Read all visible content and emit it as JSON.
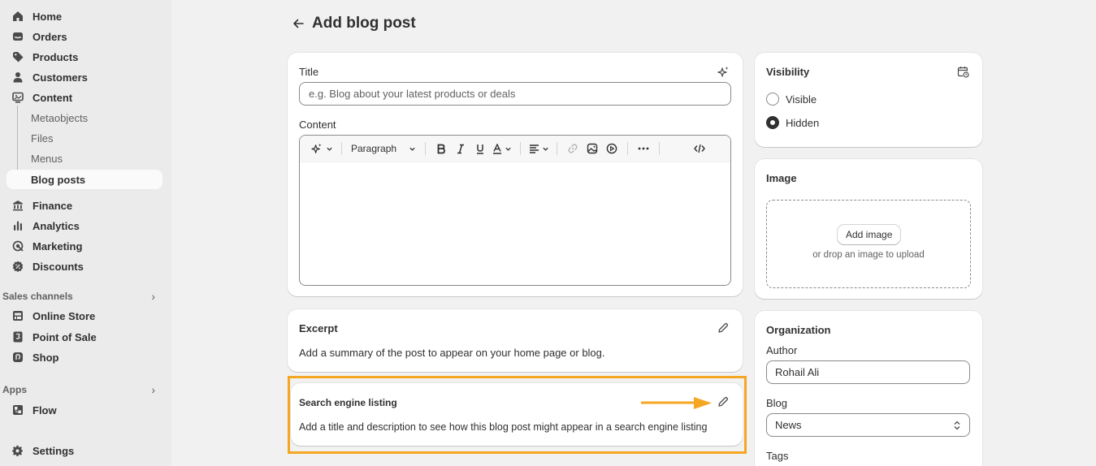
{
  "sidebar": {
    "items": [
      {
        "label": "Home",
        "icon": "home-icon"
      },
      {
        "label": "Orders",
        "icon": "inbox-icon"
      },
      {
        "label": "Products",
        "icon": "tag-icon"
      },
      {
        "label": "Customers",
        "icon": "person-icon"
      },
      {
        "label": "Content",
        "icon": "content-icon"
      }
    ],
    "content_sub": [
      "Metaobjects",
      "Files",
      "Menus",
      "Blog posts"
    ],
    "items2": [
      {
        "label": "Finance",
        "icon": "bank-icon"
      },
      {
        "label": "Analytics",
        "icon": "bar-chart-icon"
      },
      {
        "label": "Marketing",
        "icon": "target-icon"
      },
      {
        "label": "Discounts",
        "icon": "discount-icon"
      }
    ],
    "sales_channels_label": "Sales channels",
    "channels": [
      {
        "label": "Online Store",
        "icon": "store-icon"
      },
      {
        "label": "Point of Sale",
        "icon": "pos-icon"
      },
      {
        "label": "Shop",
        "icon": "shop-icon"
      }
    ],
    "apps_label": "Apps",
    "apps": [
      {
        "label": "Flow",
        "icon": "flow-icon"
      }
    ],
    "settings_label": "Settings"
  },
  "page": {
    "title": "Add blog post"
  },
  "post": {
    "title_label": "Title",
    "title_placeholder": "e.g. Blog about your latest products or deals",
    "content_label": "Content",
    "format_value": "Paragraph"
  },
  "excerpt": {
    "heading": "Excerpt",
    "description": "Add a summary of the post to appear on your home page or blog."
  },
  "seo": {
    "heading": "Search engine listing",
    "description": "Add a title and description to see how this blog post might appear in a search engine listing"
  },
  "visibility": {
    "heading": "Visibility",
    "options": [
      "Visible",
      "Hidden"
    ],
    "selected": "Hidden"
  },
  "image": {
    "heading": "Image",
    "add_button": "Add image",
    "drop_hint": "or drop an image to upload"
  },
  "organization": {
    "heading": "Organization",
    "author_label": "Author",
    "author_value": "Rohail Ali",
    "blog_label": "Blog",
    "blog_value": "News",
    "tags_label": "Tags"
  },
  "colors": {
    "highlight": "#f5a623",
    "text": "#303030",
    "sidebar_bg": "#ebebeb",
    "page_bg": "#f1f1f1"
  }
}
